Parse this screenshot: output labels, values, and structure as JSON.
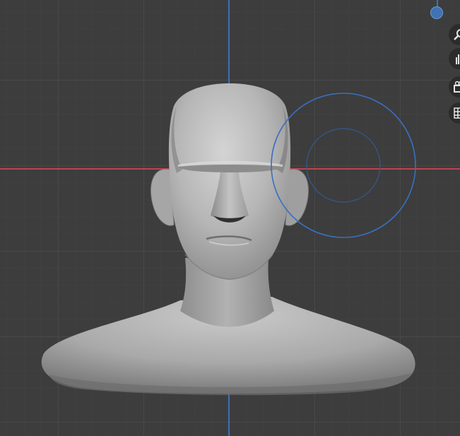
{
  "viewport": {
    "background": "#3d3d3d",
    "axis_x_color": "#c0434f",
    "axis_z_color": "#3c70b8",
    "brush_color": "#3a6fbf",
    "model": "sculpted-head-bust"
  },
  "navigation_gizmo": {
    "axis_handle": "z-axis-handle",
    "buttons": [
      {
        "icon": "zoom-magnifier-icon"
      },
      {
        "icon": "hand-pan-icon"
      },
      {
        "icon": "camera-icon"
      },
      {
        "icon": "grid-view-icon"
      }
    ]
  }
}
